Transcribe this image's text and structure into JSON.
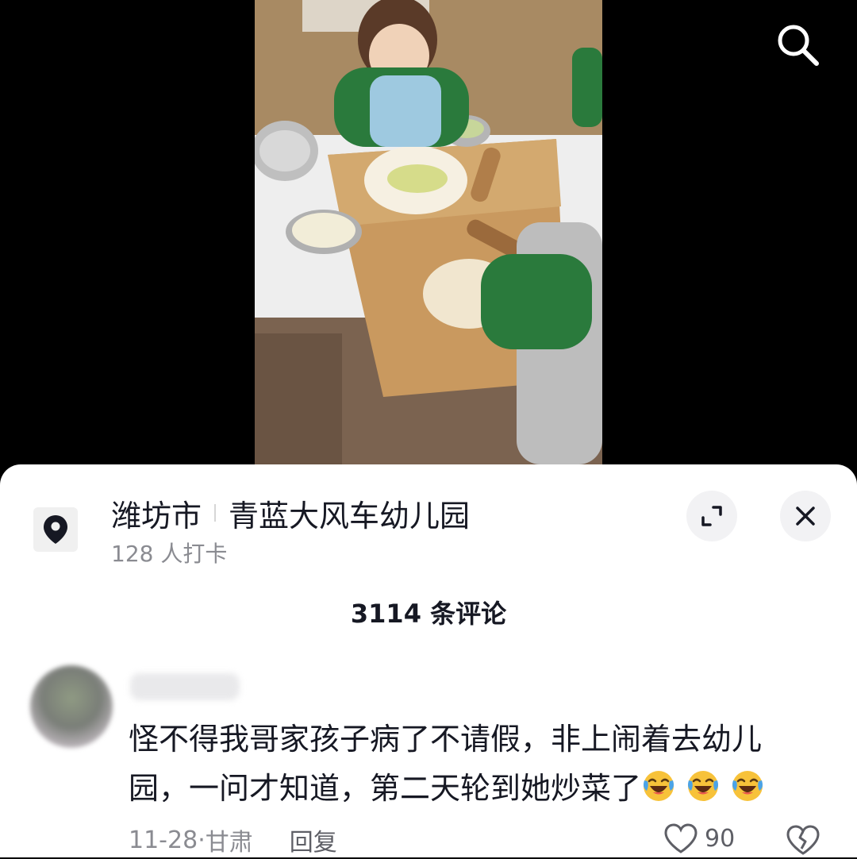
{
  "video": {
    "overlay_icon": "search-icon",
    "content": "kindergarten children rolling dough on a wooden board"
  },
  "location": {
    "icon": "location-pin-icon",
    "city": "潍坊市",
    "place": "青蓝大风车幼儿园",
    "checkins": "128 人打卡",
    "expand_icon": "expand-icon",
    "close_icon": "close-icon"
  },
  "comments": {
    "count_label": "3114 条评论",
    "items": [
      {
        "text": "怪不得我哥家孩子病了不请假，非上闹着去幼儿园，一问才知道，第二天轮到她炒菜了",
        "emoji_count": 3,
        "emoji_icon": "laughing-crying-emoji",
        "date": "11-28",
        "region": "甘肃",
        "reply_label": "回复",
        "likes": "90",
        "like_icon": "heart-outline-icon",
        "dislike_icon": "broken-heart-icon"
      }
    ]
  },
  "colors": {
    "text_primary": "#161823",
    "text_secondary": "#8a8b91",
    "sheet_bg": "#ffffff",
    "video_bg": "#000000"
  }
}
